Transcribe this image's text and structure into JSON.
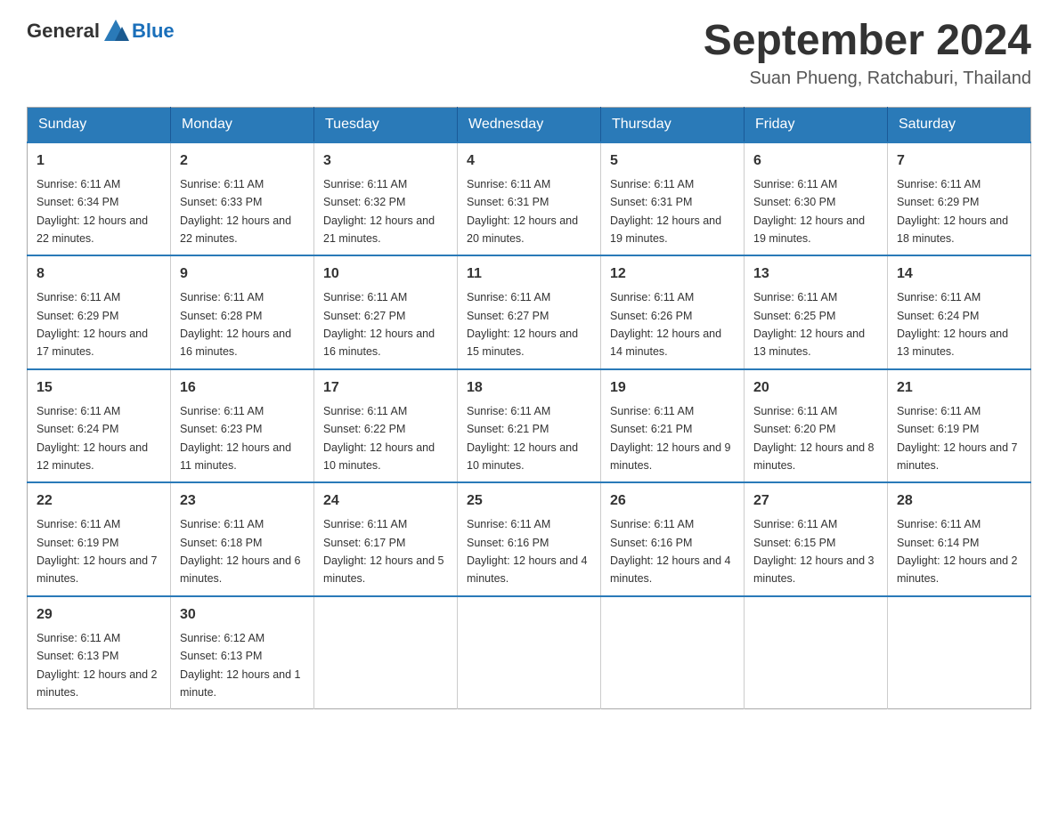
{
  "header": {
    "logo_general": "General",
    "logo_blue": "Blue",
    "title": "September 2024",
    "subtitle": "Suan Phueng, Ratchaburi, Thailand"
  },
  "days_of_week": [
    "Sunday",
    "Monday",
    "Tuesday",
    "Wednesday",
    "Thursday",
    "Friday",
    "Saturday"
  ],
  "weeks": [
    [
      {
        "day": "1",
        "sunrise": "6:11 AM",
        "sunset": "6:34 PM",
        "daylight": "12 hours and 22 minutes."
      },
      {
        "day": "2",
        "sunrise": "6:11 AM",
        "sunset": "6:33 PM",
        "daylight": "12 hours and 22 minutes."
      },
      {
        "day": "3",
        "sunrise": "6:11 AM",
        "sunset": "6:32 PM",
        "daylight": "12 hours and 21 minutes."
      },
      {
        "day": "4",
        "sunrise": "6:11 AM",
        "sunset": "6:31 PM",
        "daylight": "12 hours and 20 minutes."
      },
      {
        "day": "5",
        "sunrise": "6:11 AM",
        "sunset": "6:31 PM",
        "daylight": "12 hours and 19 minutes."
      },
      {
        "day": "6",
        "sunrise": "6:11 AM",
        "sunset": "6:30 PM",
        "daylight": "12 hours and 19 minutes."
      },
      {
        "day": "7",
        "sunrise": "6:11 AM",
        "sunset": "6:29 PM",
        "daylight": "12 hours and 18 minutes."
      }
    ],
    [
      {
        "day": "8",
        "sunrise": "6:11 AM",
        "sunset": "6:29 PM",
        "daylight": "12 hours and 17 minutes."
      },
      {
        "day": "9",
        "sunrise": "6:11 AM",
        "sunset": "6:28 PM",
        "daylight": "12 hours and 16 minutes."
      },
      {
        "day": "10",
        "sunrise": "6:11 AM",
        "sunset": "6:27 PM",
        "daylight": "12 hours and 16 minutes."
      },
      {
        "day": "11",
        "sunrise": "6:11 AM",
        "sunset": "6:27 PM",
        "daylight": "12 hours and 15 minutes."
      },
      {
        "day": "12",
        "sunrise": "6:11 AM",
        "sunset": "6:26 PM",
        "daylight": "12 hours and 14 minutes."
      },
      {
        "day": "13",
        "sunrise": "6:11 AM",
        "sunset": "6:25 PM",
        "daylight": "12 hours and 13 minutes."
      },
      {
        "day": "14",
        "sunrise": "6:11 AM",
        "sunset": "6:24 PM",
        "daylight": "12 hours and 13 minutes."
      }
    ],
    [
      {
        "day": "15",
        "sunrise": "6:11 AM",
        "sunset": "6:24 PM",
        "daylight": "12 hours and 12 minutes."
      },
      {
        "day": "16",
        "sunrise": "6:11 AM",
        "sunset": "6:23 PM",
        "daylight": "12 hours and 11 minutes."
      },
      {
        "day": "17",
        "sunrise": "6:11 AM",
        "sunset": "6:22 PM",
        "daylight": "12 hours and 10 minutes."
      },
      {
        "day": "18",
        "sunrise": "6:11 AM",
        "sunset": "6:21 PM",
        "daylight": "12 hours and 10 minutes."
      },
      {
        "day": "19",
        "sunrise": "6:11 AM",
        "sunset": "6:21 PM",
        "daylight": "12 hours and 9 minutes."
      },
      {
        "day": "20",
        "sunrise": "6:11 AM",
        "sunset": "6:20 PM",
        "daylight": "12 hours and 8 minutes."
      },
      {
        "day": "21",
        "sunrise": "6:11 AM",
        "sunset": "6:19 PM",
        "daylight": "12 hours and 7 minutes."
      }
    ],
    [
      {
        "day": "22",
        "sunrise": "6:11 AM",
        "sunset": "6:19 PM",
        "daylight": "12 hours and 7 minutes."
      },
      {
        "day": "23",
        "sunrise": "6:11 AM",
        "sunset": "6:18 PM",
        "daylight": "12 hours and 6 minutes."
      },
      {
        "day": "24",
        "sunrise": "6:11 AM",
        "sunset": "6:17 PM",
        "daylight": "12 hours and 5 minutes."
      },
      {
        "day": "25",
        "sunrise": "6:11 AM",
        "sunset": "6:16 PM",
        "daylight": "12 hours and 4 minutes."
      },
      {
        "day": "26",
        "sunrise": "6:11 AM",
        "sunset": "6:16 PM",
        "daylight": "12 hours and 4 minutes."
      },
      {
        "day": "27",
        "sunrise": "6:11 AM",
        "sunset": "6:15 PM",
        "daylight": "12 hours and 3 minutes."
      },
      {
        "day": "28",
        "sunrise": "6:11 AM",
        "sunset": "6:14 PM",
        "daylight": "12 hours and 2 minutes."
      }
    ],
    [
      {
        "day": "29",
        "sunrise": "6:11 AM",
        "sunset": "6:13 PM",
        "daylight": "12 hours and 2 minutes."
      },
      {
        "day": "30",
        "sunrise": "6:12 AM",
        "sunset": "6:13 PM",
        "daylight": "12 hours and 1 minute."
      },
      null,
      null,
      null,
      null,
      null
    ]
  ]
}
